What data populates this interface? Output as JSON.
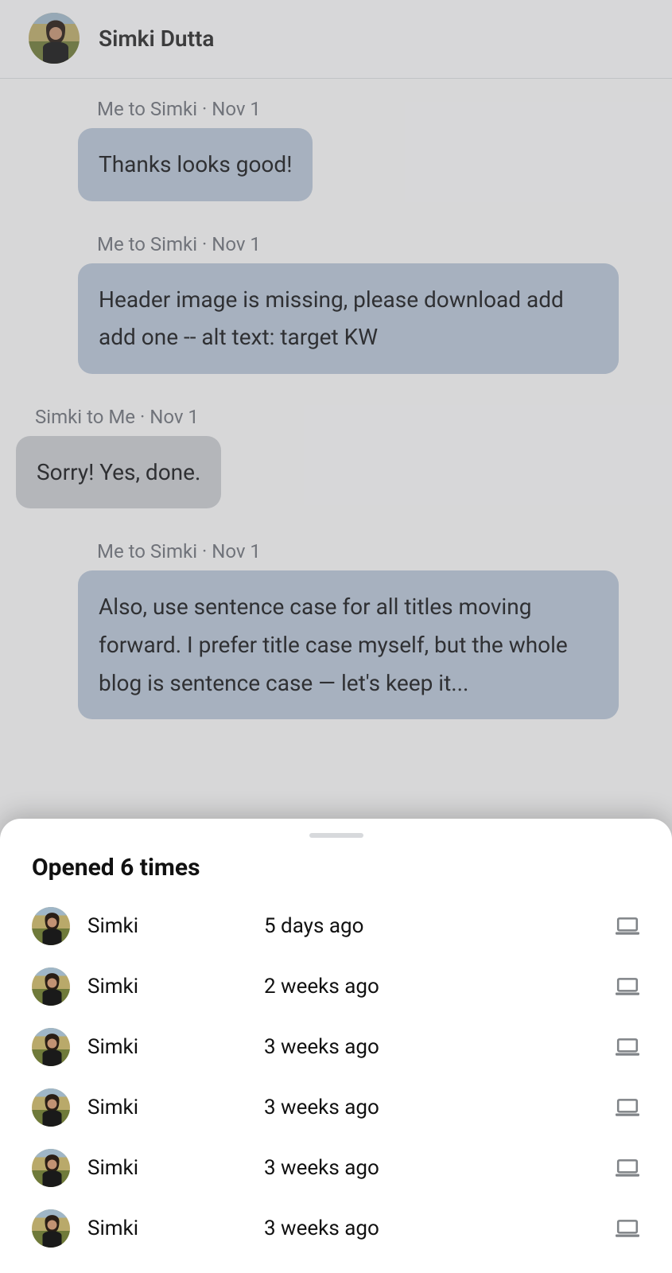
{
  "header": {
    "contact_name": "Simki Dutta"
  },
  "messages": [
    {
      "direction": "out",
      "meta": "Me to Simki · Nov 1",
      "text": "Thanks looks good!"
    },
    {
      "direction": "out",
      "meta": "Me to Simki · Nov 1",
      "text": "Header image is missing, please download add add one -- alt text: target KW"
    },
    {
      "direction": "in",
      "meta": "Simki to Me · Nov 1",
      "text": "Sorry! Yes, done."
    },
    {
      "direction": "out",
      "meta": "Me to Simki · Nov 1",
      "text": "Also, use sentence case for all titles moving forward. I prefer title case myself, but the whole blog is sentence case — let's keep it..."
    }
  ],
  "sheet": {
    "title": "Opened 6 times",
    "rows": [
      {
        "name": "Simki",
        "when": "5 days ago",
        "device": "laptop"
      },
      {
        "name": "Simki",
        "when": "2 weeks ago",
        "device": "laptop"
      },
      {
        "name": "Simki",
        "when": "3 weeks ago",
        "device": "laptop"
      },
      {
        "name": "Simki",
        "when": "3 weeks ago",
        "device": "laptop"
      },
      {
        "name": "Simki",
        "when": "3 weeks ago",
        "device": "laptop"
      },
      {
        "name": "Simki",
        "when": "3 weeks ago",
        "device": "laptop"
      }
    ]
  }
}
